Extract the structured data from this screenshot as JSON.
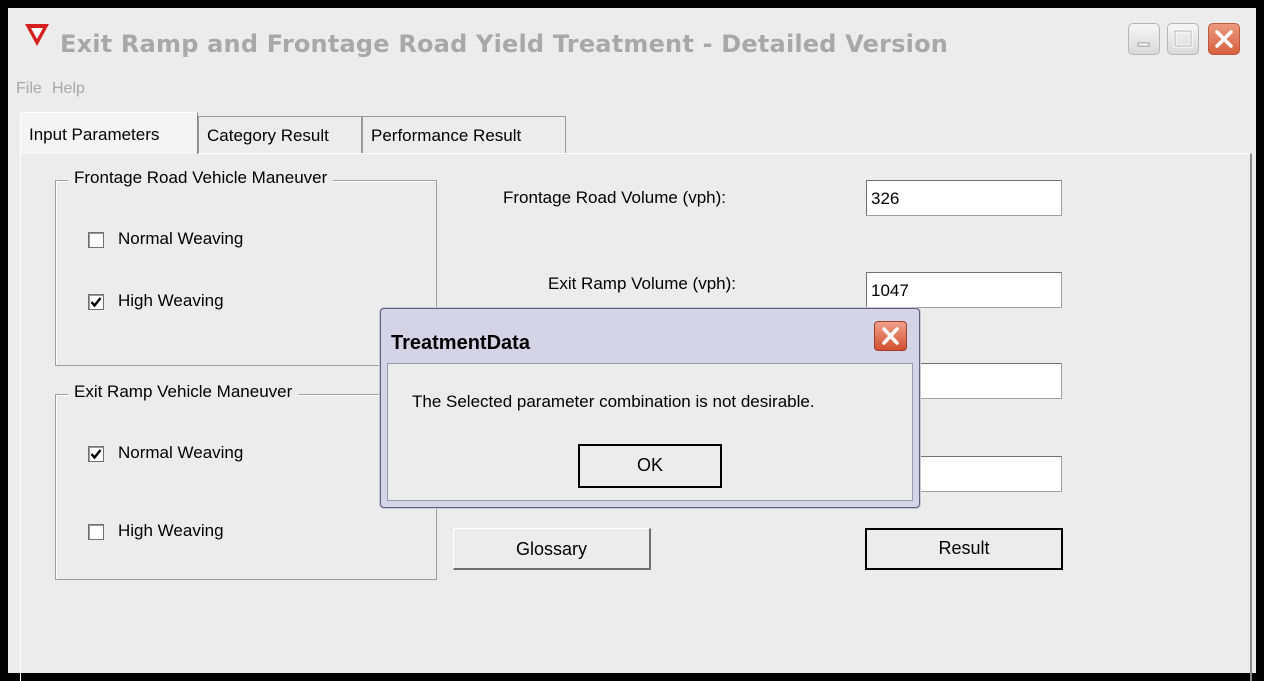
{
  "window": {
    "title": "Exit Ramp and Frontage Road Yield Treatment - Detailed Version",
    "controls": {
      "minimize_icon": "minimize-icon",
      "maximize_icon": "maximize-icon",
      "close_icon": "close-icon"
    }
  },
  "menu": {
    "items": [
      "File",
      "Help"
    ]
  },
  "tabs": [
    {
      "label": "Input Parameters",
      "active": true
    },
    {
      "label": "Category Result",
      "active": false
    },
    {
      "label": "Performance Result",
      "active": false
    }
  ],
  "frontage_group": {
    "title": "Frontage Road Vehicle Maneuver",
    "options": [
      {
        "label": "Normal Weaving",
        "checked": false
      },
      {
        "label": "High Weaving",
        "checked": true
      }
    ]
  },
  "exit_group": {
    "title": "Exit Ramp Vehicle Maneuver",
    "options": [
      {
        "label": "Normal Weaving",
        "checked": true
      },
      {
        "label": "High Weaving",
        "checked": false
      }
    ]
  },
  "fields": {
    "frontage_volume": {
      "label": "Frontage Road Volume (vph):",
      "value": "326"
    },
    "exit_volume": {
      "label": "Exit Ramp Volume (vph):",
      "value": "1047"
    },
    "field3": {
      "value": ""
    },
    "field4": {
      "value": ""
    }
  },
  "buttons": {
    "glossary": "Glossary",
    "result": "Result"
  },
  "dialog": {
    "title": "TreatmentData",
    "message": "The Selected parameter combination is not desirable.",
    "ok": "OK"
  },
  "colors": {
    "accent_red": "#d62020",
    "disabled_text": "#a8a8a8",
    "dialog_frame": "#d5d3e6"
  }
}
